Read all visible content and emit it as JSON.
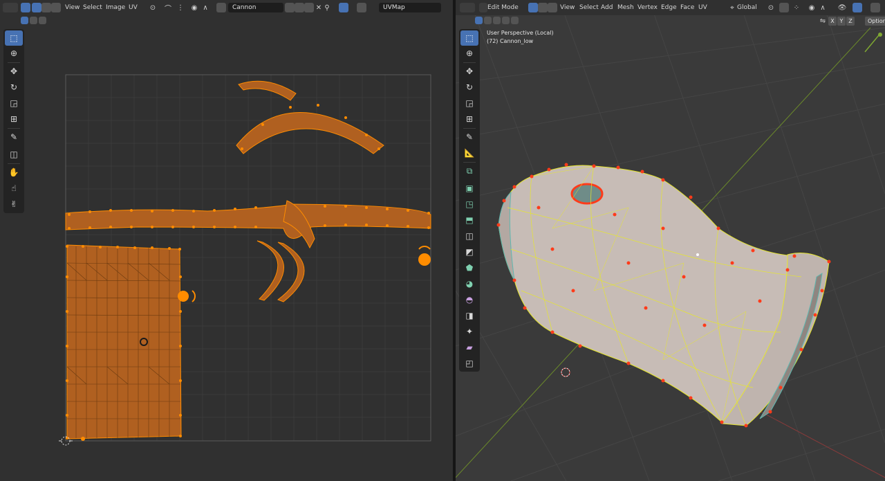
{
  "uv_editor": {
    "menu": [
      "View",
      "Select",
      "Image",
      "UV"
    ],
    "image_name": "Cannon",
    "uv_map": "UVMap"
  },
  "viewport": {
    "mode": "Edit Mode",
    "menu": [
      "View",
      "Select",
      "Add",
      "Mesh",
      "Vertex",
      "Edge",
      "Face",
      "UV"
    ],
    "orientation": "Global",
    "axes": [
      "X",
      "Y",
      "Z"
    ],
    "options": "Options",
    "overlay_title": "User Perspective (Local)",
    "overlay_object": "(72) Cannon_low"
  },
  "colors": {
    "uv_face": "#b06020",
    "uv_vertex": "#ff8c00",
    "selected_vertex": "#ff3b1a",
    "mesh_surface": "#c7bcb6",
    "edge_highlight": "#e6e62e",
    "accent": "#4772b3"
  },
  "icons": {
    "uv_tools": [
      "select-box-icon",
      "cursor-icon",
      "move-icon",
      "rotate-icon",
      "scale-icon",
      "transform-icon",
      "annotate-icon",
      "rip-region-icon",
      "grab-icon",
      "relax-icon",
      "pinch-icon"
    ],
    "vp_tools": [
      "select-box-icon",
      "cursor-icon",
      "move-icon",
      "rotate-icon",
      "scale-icon",
      "transform-icon",
      "annotate-icon",
      "measure-icon",
      "add-cube-icon",
      "extrude-icon",
      "inset-icon",
      "bevel-icon",
      "loop-cut-icon",
      "knife-icon",
      "poly-build-icon",
      "spin-icon",
      "smooth-icon",
      "edge-slide-icon",
      "shrink-icon",
      "shear-icon",
      "rip-icon"
    ]
  }
}
